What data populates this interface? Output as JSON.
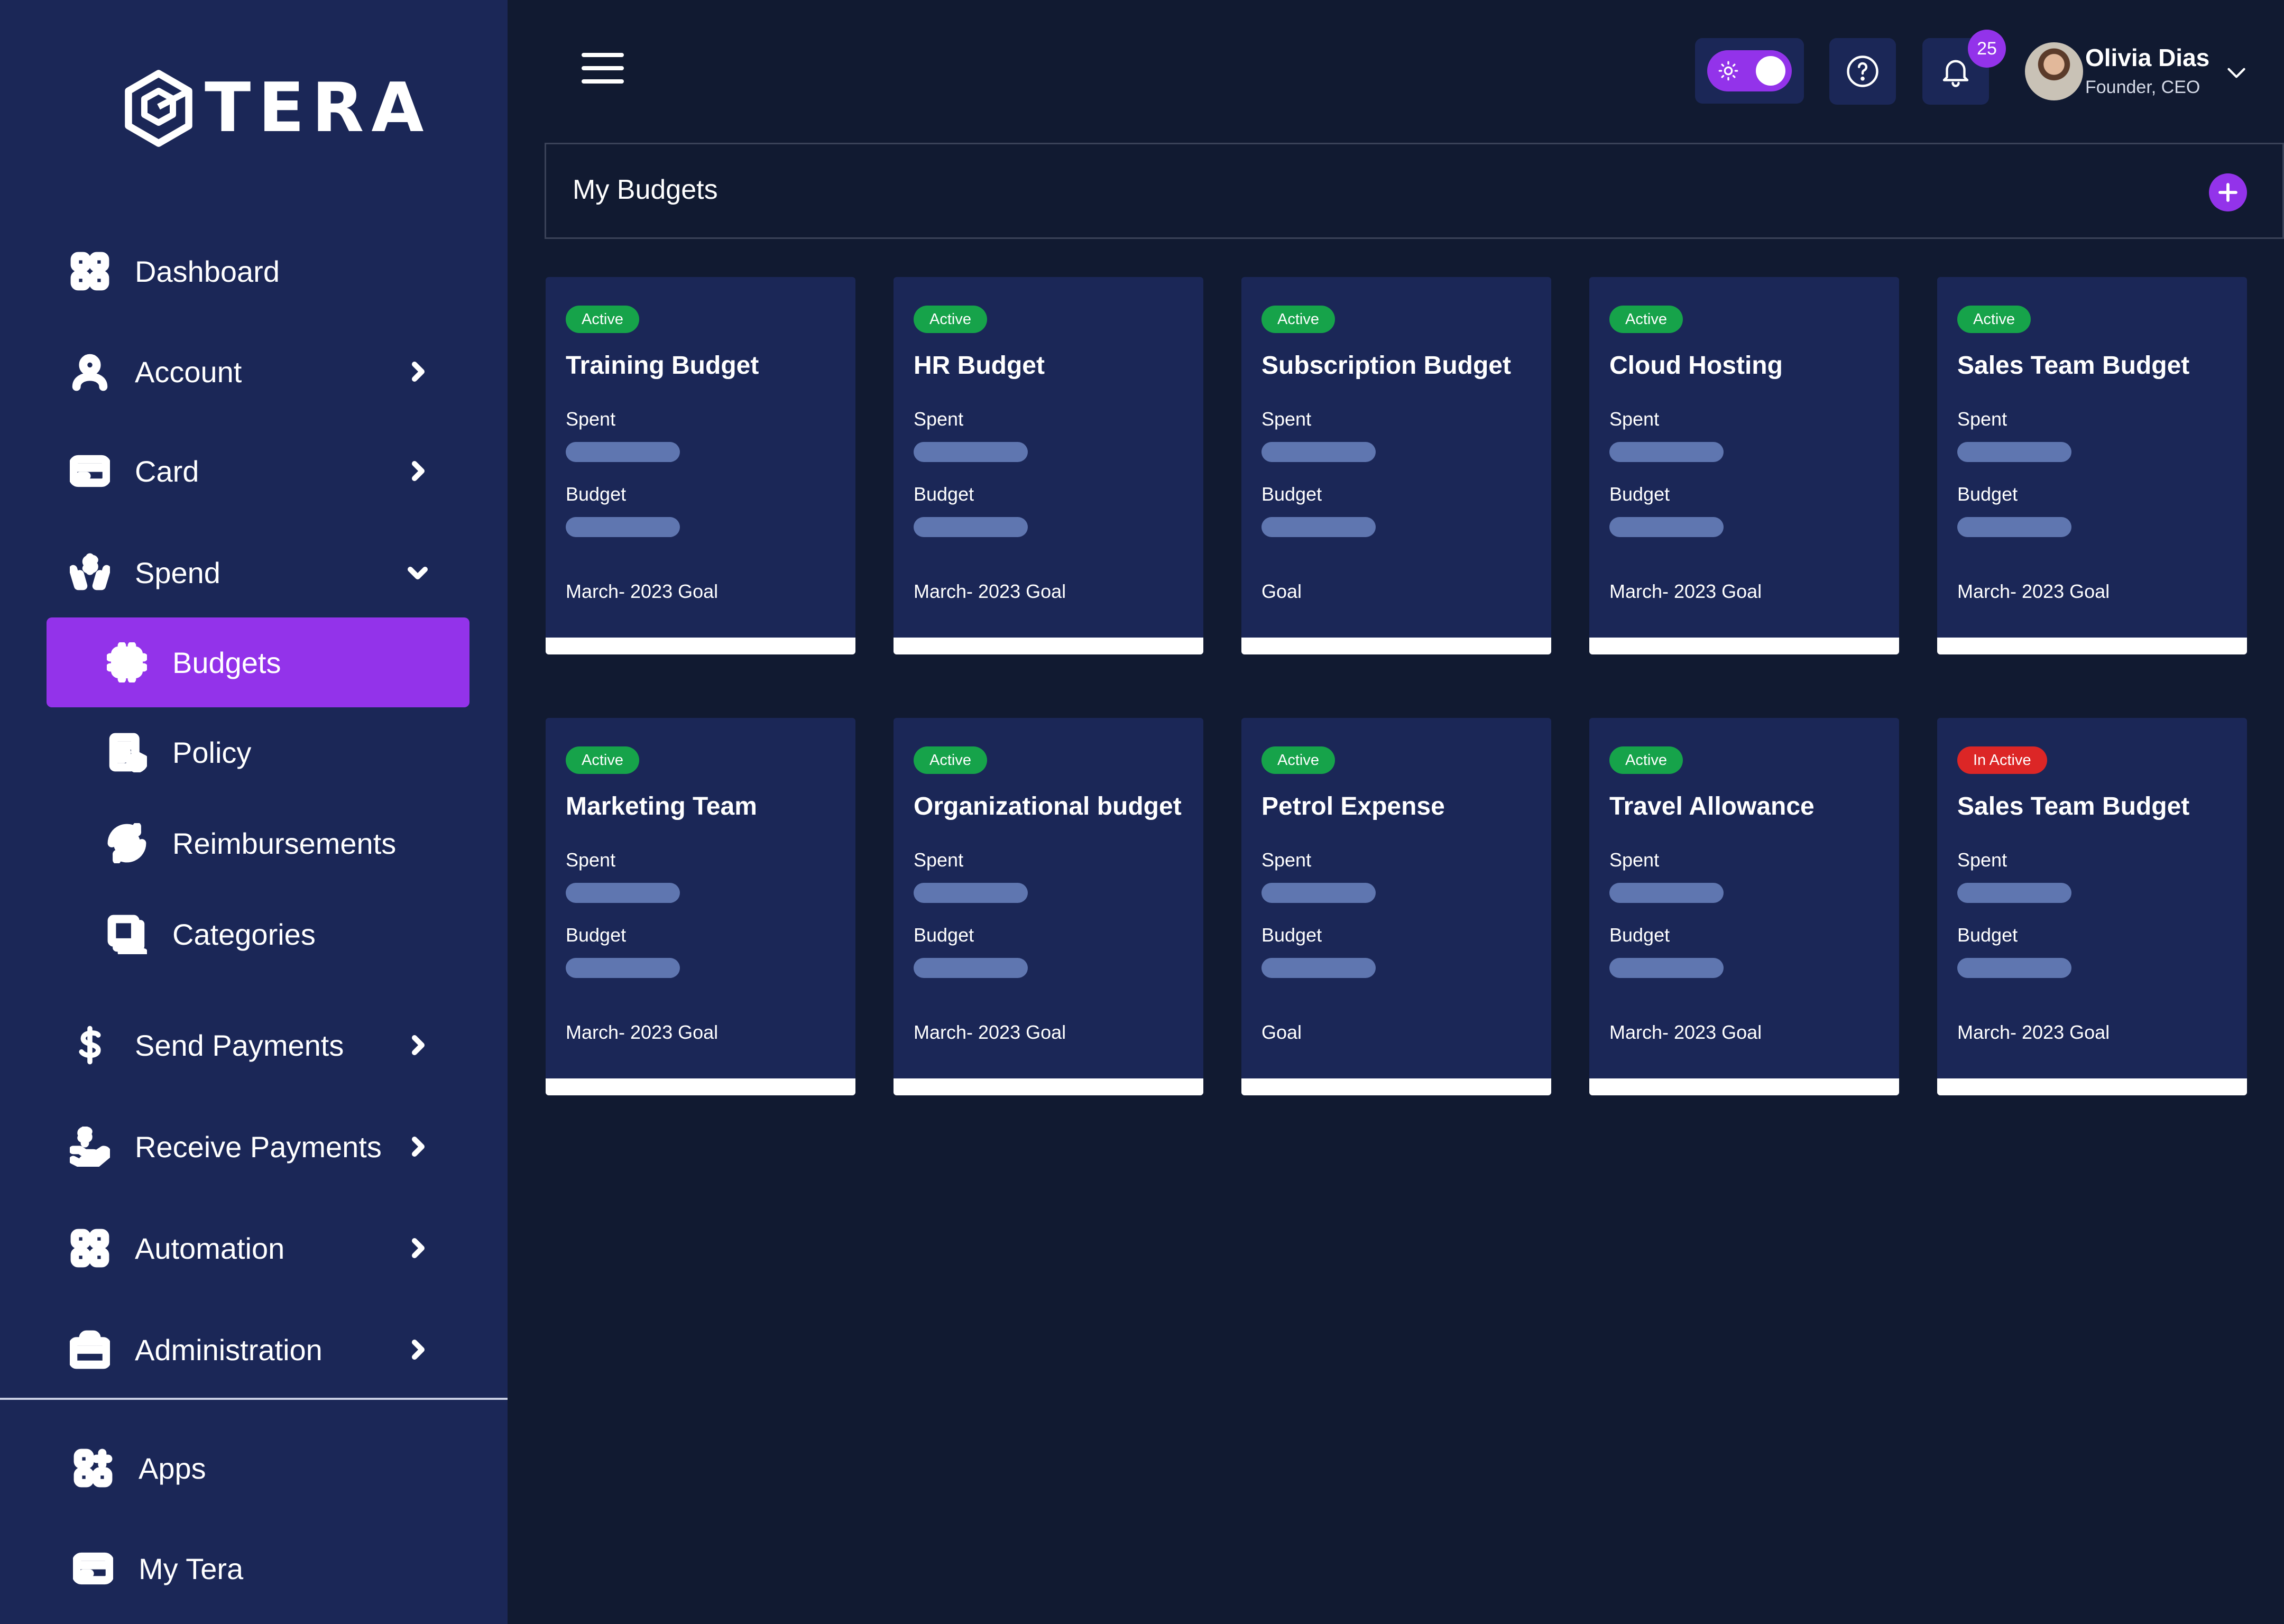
{
  "brand": {
    "name": "TERA"
  },
  "sidebar": {
    "items": [
      {
        "label": "Dashboard",
        "icon": "grid-icon",
        "chevron": ""
      },
      {
        "label": "Account",
        "icon": "user-icon",
        "chevron": "right"
      },
      {
        "label": "Card",
        "icon": "credit-card-icon",
        "chevron": "right"
      },
      {
        "label": "Spend",
        "icon": "money-hands-icon",
        "chevron": "down"
      },
      {
        "label": "Send Payments",
        "icon": "dollar-icon",
        "chevron": "right"
      },
      {
        "label": "Receive Payments",
        "icon": "hand-coin-icon",
        "chevron": "right"
      },
      {
        "label": "Automation",
        "icon": "grid-icon",
        "chevron": "right"
      },
      {
        "label": "Administration",
        "icon": "briefcase-icon",
        "chevron": "right"
      },
      {
        "label": "Apps",
        "icon": "apps-add-icon",
        "chevron": ""
      },
      {
        "label": "My Tera",
        "icon": "credit-card-icon",
        "chevron": ""
      }
    ],
    "spend_sub": [
      {
        "label": "Budgets",
        "icon": "chip-icon",
        "active": true
      },
      {
        "label": "Policy",
        "icon": "policy-check-icon",
        "active": false
      },
      {
        "label": "Reimbursements",
        "icon": "refund-coin-icon",
        "active": false
      },
      {
        "label": "Categories",
        "icon": "stacked-cards-icon",
        "active": false
      }
    ]
  },
  "topbar": {
    "notifications_count": "25",
    "user": {
      "name": "Olivia Dias",
      "role": "Founder, CEO"
    }
  },
  "page": {
    "title": "My Budgets"
  },
  "labels": {
    "spent": "Spent",
    "budget": "Budget"
  },
  "colors": {
    "accent": "#9333ea",
    "sidebar_bg": "#1b2757",
    "page_bg": "#111a31",
    "active_badge": "#16a34a",
    "inactive_badge": "#dc2626",
    "bar": "#5f76b0"
  },
  "budgets": [
    {
      "status": "Active",
      "title": "Training Budget",
      "goal": "March- 2023 Goal"
    },
    {
      "status": "Active",
      "title": "HR Budget",
      "goal": "March- 2023 Goal"
    },
    {
      "status": "Active",
      "title": "Subscription Budget",
      "goal": "Goal"
    },
    {
      "status": "Active",
      "title": "Cloud Hosting",
      "goal": "March- 2023 Goal"
    },
    {
      "status": "Active",
      "title": "Sales Team Budget",
      "goal": "March- 2023 Goal"
    },
    {
      "status": "Active",
      "title": "Marketing Team",
      "goal": "March- 2023 Goal"
    },
    {
      "status": "Active",
      "title": "Organizational budget",
      "goal": "March- 2023 Goal"
    },
    {
      "status": "Active",
      "title": "Petrol Expense",
      "goal": "Goal"
    },
    {
      "status": "Active",
      "title": "Travel Allowance",
      "goal": "March- 2023 Goal"
    },
    {
      "status": "In Active",
      "title": "Sales Team Budget",
      "goal": "March- 2023 Goal"
    }
  ]
}
